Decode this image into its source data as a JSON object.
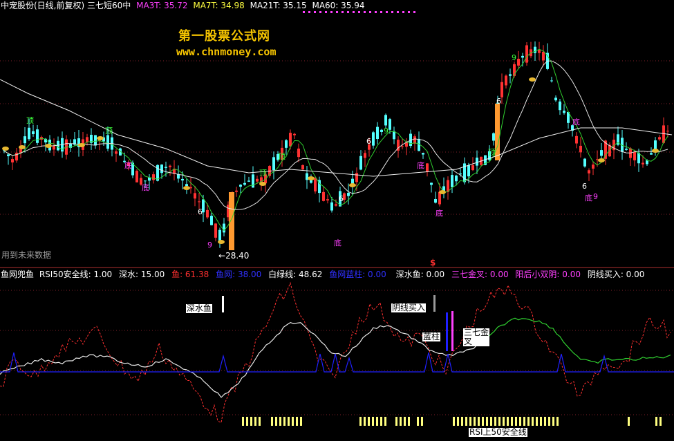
{
  "colors": {
    "bg": "#000000",
    "up": "#ff3232",
    "down": "#54ffff",
    "ma3": "#ff00ff",
    "ma7": "#ffff00",
    "ma21": "#ffffff",
    "ma60": "#ffffff",
    "green_line": "#2fcf2f",
    "white_line": "#e8e8e8",
    "fish_dash": "#ff3030",
    "net_line": "#2020ff",
    "yellow_bar": "#ffff80",
    "label_magenta": "#ff40ff",
    "label_green": "#3cff3c",
    "grid": "#80202a"
  },
  "header": {
    "title": "中宠股份(日线,前复权) 三七短60中",
    "ma3": "MA3T: 35.72",
    "ma7": "MA7T: 34.98",
    "ma21": "MA21T: 35.15",
    "ma60": "MA60: 35.94"
  },
  "watermark": {
    "line1": "第一股票公式网",
    "line2": "www.chnmoney.com"
  },
  "upper_notes": {
    "future_data": "用到未来数据",
    "low_price": "28.40",
    "s_marker": "$"
  },
  "lower_header": {
    "name": "鱼网兜鱼",
    "rsi50": "RSI50安全线: 1.00",
    "deep_water": "深水: 15.00",
    "fish": "鱼: 61.38",
    "net": "鱼网: 38.00",
    "white_line": "白绿线: 48.62",
    "net_bar": "鱼网蓝柱: 0.00",
    "deep_fish": "深水鱼: 0.00",
    "golden_cross": "三七金叉: 0.00",
    "double_yin": "阳后小双阴: 0.00",
    "yin_buy": "阴线买入: 0.00"
  },
  "lower_tags": {
    "deep_fish": "深水鱼",
    "yin_buy": "阴线买入",
    "blue_bar": "蓝柱",
    "golden_cross_1": "三七金",
    "golden_cross_2": "叉",
    "rsi_safe": "RSI上50安全线"
  },
  "chart_data": [
    {
      "type": "candlestick",
      "title": "中宠股份(日线,前复权) 三七短60中",
      "series": [
        {
          "name": "MA3T",
          "last": 35.72
        },
        {
          "name": "MA7T",
          "last": 34.98
        },
        {
          "name": "MA21T",
          "last": 35.15
        },
        {
          "name": "MA60",
          "last": 35.94
        }
      ],
      "annotations": [
        "顶",
        "底",
        "6",
        "9",
        "28.40",
        "用到未来数据"
      ],
      "min_low": 28.4
    },
    {
      "type": "line",
      "title": "鱼网兜鱼",
      "series": [
        {
          "name": "RSI50安全线",
          "last": 1.0
        },
        {
          "name": "深水",
          "last": 15.0
        },
        {
          "name": "鱼",
          "last": 61.38
        },
        {
          "name": "鱼网",
          "last": 38.0
        },
        {
          "name": "白绿线",
          "last": 48.62
        },
        {
          "name": "鱼网蓝柱",
          "last": 0.0
        },
        {
          "name": "深水鱼",
          "last": 0.0
        },
        {
          "name": "三七金叉",
          "last": 0.0
        },
        {
          "name": "阳后小双阴",
          "last": 0.0
        },
        {
          "name": "阴线买入",
          "last": 0.0
        }
      ]
    }
  ]
}
